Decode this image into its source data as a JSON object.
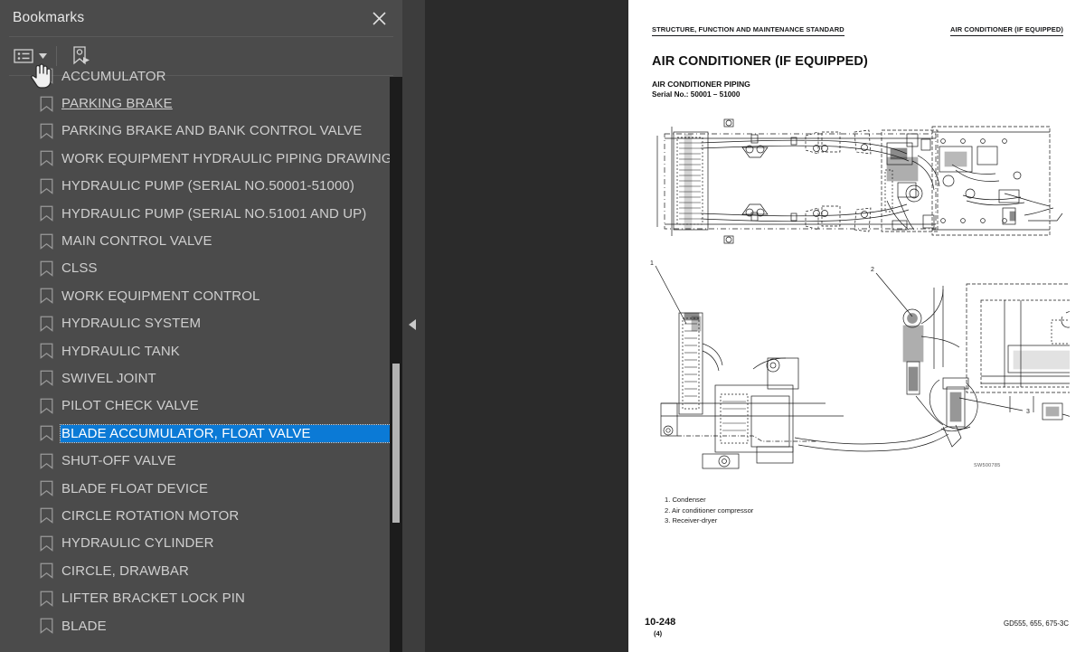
{
  "sidebar": {
    "title": "Bookmarks",
    "close_icon": "close-icon",
    "toolbar": {
      "options_icon": "list-options-icon",
      "caret_icon": "chevron-down-icon",
      "new_bookmark_icon": "new-bookmark-icon"
    },
    "items": [
      {
        "label": "ACCUMULATOR",
        "state": "partial"
      },
      {
        "label": "PARKING BRAKE",
        "state": "hover"
      },
      {
        "label": "PARKING BRAKE AND BANK CONTROL VALVE",
        "state": "normal"
      },
      {
        "label": "WORK EQUIPMENT HYDRAULIC PIPING DRAWING",
        "state": "normal"
      },
      {
        "label": "HYDRAULIC PUMP (SERIAL NO.50001-51000)",
        "state": "normal"
      },
      {
        "label": "HYDRAULIC PUMP (SERIAL NO.51001 AND UP)",
        "state": "normal"
      },
      {
        "label": "MAIN CONTROL VALVE",
        "state": "normal"
      },
      {
        "label": "CLSS",
        "state": "normal"
      },
      {
        "label": "WORK EQUIPMENT CONTROL",
        "state": "normal"
      },
      {
        "label": "HYDRAULIC SYSTEM",
        "state": "normal"
      },
      {
        "label": "HYDRAULIC TANK",
        "state": "normal"
      },
      {
        "label": "SWIVEL JOINT",
        "state": "normal"
      },
      {
        "label": "PILOT CHECK VALVE",
        "state": "normal"
      },
      {
        "label": "BLADE ACCUMULATOR, FLOAT VALVE",
        "state": "selected"
      },
      {
        "label": "SHUT-OFF VALVE",
        "state": "normal"
      },
      {
        "label": "BLADE FLOAT DEVICE",
        "state": "normal"
      },
      {
        "label": "CIRCLE ROTATION MOTOR",
        "state": "normal"
      },
      {
        "label": "HYDRAULIC CYLINDER",
        "state": "normal"
      },
      {
        "label": "CIRCLE, DRAWBAR",
        "state": "normal"
      },
      {
        "label": "LIFTER BRACKET LOCK PIN",
        "state": "normal"
      },
      {
        "label": "BLADE",
        "state": "normal"
      }
    ],
    "scrollbar": {
      "name": "bookmarks-scrollbar"
    }
  },
  "splitter": {
    "collapse_icon": "collapse-left-arrow-icon"
  },
  "document": {
    "header_left": "STRUCTURE, FUNCTION AND MAINTENANCE STANDARD",
    "header_right": "AIR CONDITIONER (IF EQUIPPED)",
    "title": "AIR CONDITIONER (IF EQUIPPED)",
    "subtitle": "AIR CONDITIONER PIPING",
    "serial": "Serial No.: 50001 – 51000",
    "figure_top_name": "air-conditioner-piping-top-view",
    "figure_bottom_name": "air-conditioner-piping-side-view",
    "figure_id": "SW500785",
    "callouts": [
      "1",
      "2",
      "3"
    ],
    "legend": [
      "1. Condenser",
      "2. Air conditioner compressor",
      "3. Receiver-dryer"
    ],
    "footer_page": "10-248",
    "footer_page_sub": "(4)",
    "footer_model": "GD555, 655, 675-3C"
  },
  "colors": {
    "panel_bg": "#4b4b4b",
    "viewer_bg": "#2b2b2b",
    "selection_blue": "#0b7ad6",
    "text": "#cfcfcf",
    "scroll_track": "#1c1c1c",
    "scroll_thumb": "#b3b3b3"
  }
}
